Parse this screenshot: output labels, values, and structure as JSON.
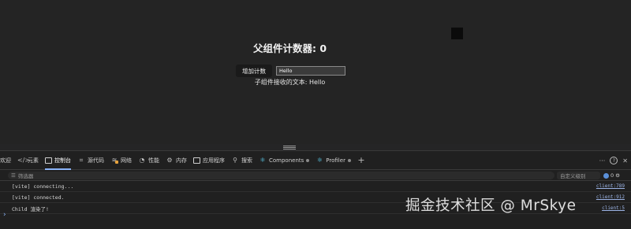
{
  "app": {
    "counter_title": "父组件计数器: 0",
    "increment_button": "增加计数",
    "input_value": "Hello",
    "child_text": "子组件接收的文本: Hello"
  },
  "devtools": {
    "tabs": [
      {
        "label": "欢迎",
        "icon": "welcome-icon"
      },
      {
        "label": "元素",
        "icon": "code-icon"
      },
      {
        "label": "控制台",
        "icon": "console-icon"
      },
      {
        "label": "源代码",
        "icon": "sources-icon"
      },
      {
        "label": "网络",
        "icon": "wifi-icon"
      },
      {
        "label": "性能",
        "icon": "gauge-icon"
      },
      {
        "label": "内存",
        "icon": "memory-icon"
      },
      {
        "label": "应用程序",
        "icon": "application-icon"
      },
      {
        "label": "搜索",
        "icon": "search-icon"
      },
      {
        "label": "Components",
        "icon": "react-icon"
      },
      {
        "label": "Profiler",
        "icon": "react-icon"
      }
    ],
    "active_tab": "控制台",
    "filter_placeholder": "筛选器",
    "level_select": "自定义级别",
    "issue_count": "0",
    "console_logs": [
      {
        "message": "[vite] connecting...",
        "source": "client:789"
      },
      {
        "message": "[vite] connected.",
        "source": "client:912"
      },
      {
        "message": "Child 渲染了!",
        "source": "client:5"
      }
    ]
  },
  "watermark": "掘金技术社区 @ MrSkye",
  "colors": {
    "background": "#242424",
    "devtools_bg": "#202020",
    "active_tab_underline": "#8ab4f8",
    "link": "#9cb4e6"
  }
}
